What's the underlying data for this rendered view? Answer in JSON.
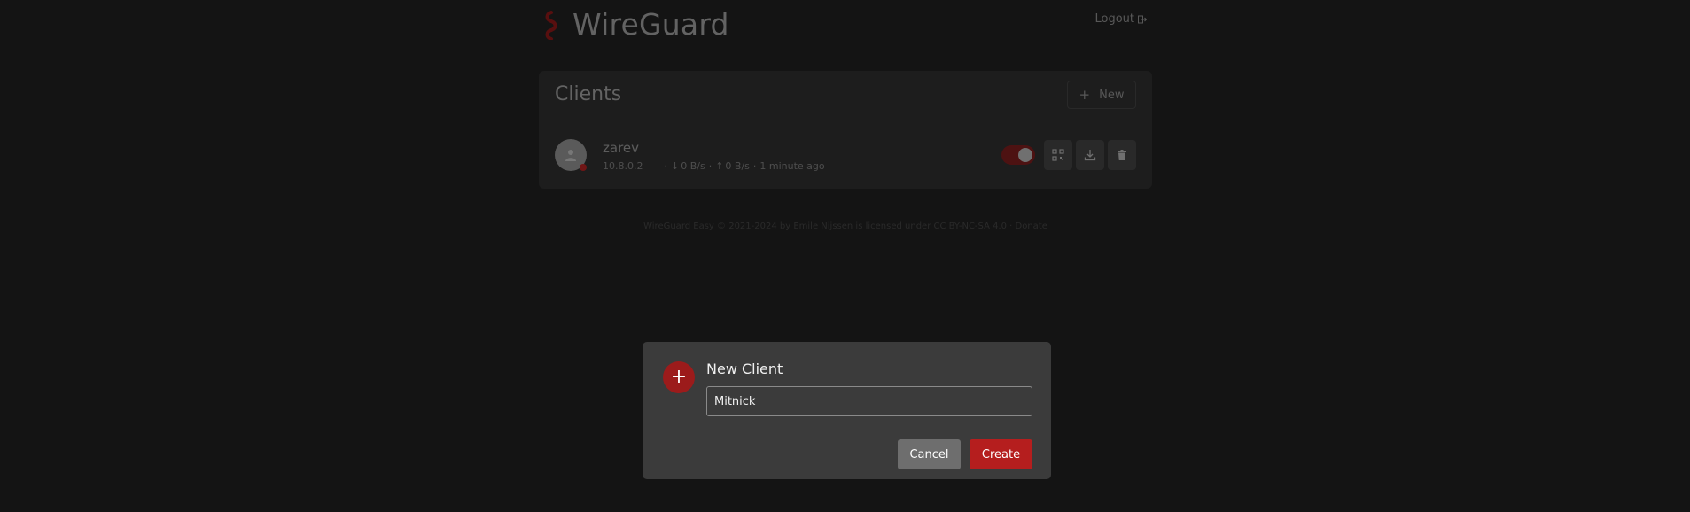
{
  "header": {
    "brand_title": "WireGuard",
    "logout_label": "Logout"
  },
  "clients_card": {
    "title": "Clients",
    "new_button_label": "New",
    "clients": [
      {
        "name": "zarev",
        "ip": "10.8.0.2",
        "download": "0 B/s",
        "upload": "0 B/s",
        "last_seen": "1 minute ago",
        "enabled": true
      }
    ]
  },
  "footer": {
    "text": "WireGuard Easy © 2021-2024 by Emile Nijssen is licensed under CC BY-NC-SA 4.0 · Donate"
  },
  "modal": {
    "title": "New Client",
    "input_value": "Mitnick",
    "cancel_label": "Cancel",
    "create_label": "Create"
  },
  "colors": {
    "accent": "#b51e1e",
    "background": "#1c1c1c",
    "card": "#292929",
    "modal": "#3b3b3b"
  }
}
